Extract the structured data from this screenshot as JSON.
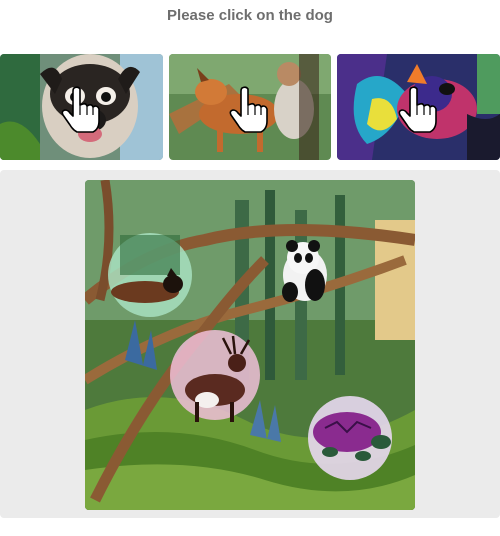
{
  "prompt": {
    "text": "Please click on the dog"
  },
  "choices": [
    {
      "label": "pug dog",
      "icon": "hand-pointer-icon"
    },
    {
      "label": "brown dog",
      "icon": "hand-pointer-icon"
    },
    {
      "label": "colorful dog",
      "icon": "hand-pointer-icon"
    }
  ],
  "challenge_image": {
    "description_items": [
      "dog",
      "panda",
      "deer",
      "turtle"
    ]
  },
  "colors": {
    "prompt_text": "#6e6e6e",
    "panel_bg": "#ebebeb",
    "hand_fill": "#ffffff",
    "hand_stroke": "#000000"
  }
}
